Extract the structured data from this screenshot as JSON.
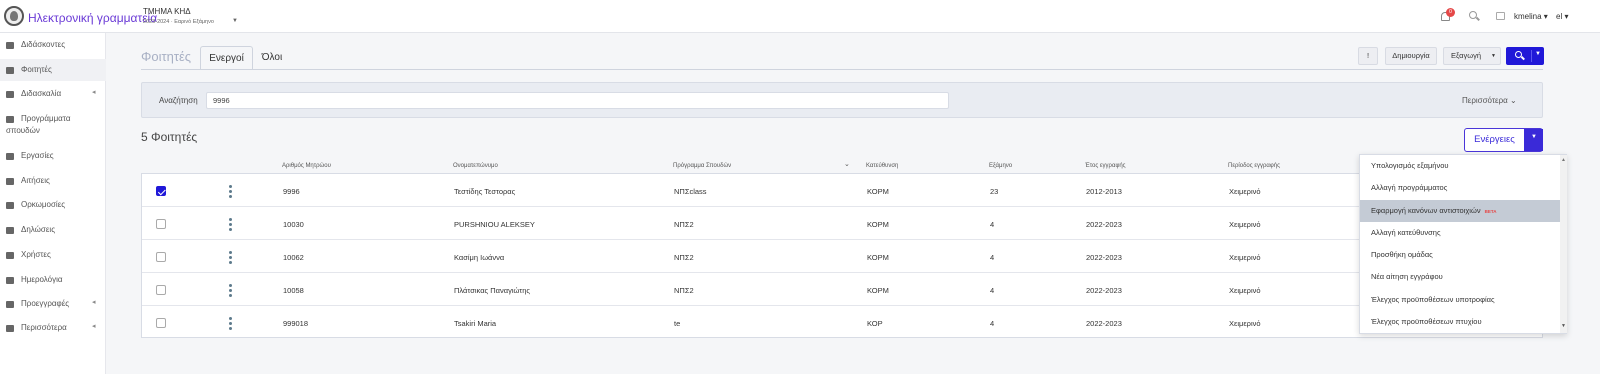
{
  "header": {
    "app_title": "Ηλεκτρονική γραμματεία",
    "department": "ΤΜΗΜΑ ΚΗΔ",
    "period": "2023-2024 · Εαρινό Εξάμηνο",
    "notification_count": "0",
    "username": "kmelina",
    "language": "el"
  },
  "sidebar": {
    "items": [
      {
        "label": "Διδάσκοντες",
        "icon": "megaphone-icon"
      },
      {
        "label": "Φοιτητές",
        "icon": "graduation-cap-icon"
      },
      {
        "label": "Διδασκαλία",
        "icon": "history-icon"
      },
      {
        "label": "Προγράμματα σπουδών",
        "icon": "institution-icon"
      },
      {
        "label": "Εργασίες",
        "icon": "briefcase-icon"
      },
      {
        "label": "Αιτήσεις",
        "icon": "envelope-icon"
      },
      {
        "label": "Ορκωμοσίες",
        "icon": "user-graduate-icon"
      },
      {
        "label": "Δηλώσεις",
        "icon": "copy-icon"
      },
      {
        "label": "Χρήστες",
        "icon": "user-icon"
      },
      {
        "label": "Ημερολόγια",
        "icon": "calendar-icon"
      },
      {
        "label": "Προεγγραφές",
        "icon": "file-icon"
      },
      {
        "label": "Περισσότερα",
        "icon": "more-icon"
      }
    ]
  },
  "page": {
    "title": "Φοιτητές",
    "tabs": [
      "Ενεργοί",
      "Όλοι"
    ],
    "toolbar": {
      "info": "!",
      "create": "Δημιουργία",
      "export": "Εξαγωγή"
    }
  },
  "filter": {
    "label": "Αναζήτηση",
    "value": "9996",
    "more": "Περισσότερα"
  },
  "results": {
    "count_label": "5 Φοιτητές",
    "actions_label": "Ενέργειες"
  },
  "table": {
    "columns": [
      "Αριθμός Μητρώου",
      "Ονοματεπώνυμο",
      "Πρόγραμμα Σπουδών",
      "Κατεύθυνση",
      "Εξάμηνο",
      "Έτος εγγραφής",
      "Περίοδος εγγραφής"
    ],
    "rows": [
      {
        "checked": true,
        "id": "9996",
        "name": "Τεστίδης Τεστορας",
        "program": "ΝΠΣclass",
        "direction": "ΚΟΡΜ",
        "semester": "23",
        "year": "2012-2013",
        "period": "Χειμερινό"
      },
      {
        "checked": false,
        "id": "10030",
        "name": "PURSHNIOU ALEKSEY",
        "program": "ΝΠΣ2",
        "direction": "ΚΟΡΜ",
        "semester": "4",
        "year": "2022-2023",
        "period": "Χειμερινό"
      },
      {
        "checked": false,
        "id": "10062",
        "name": "Κασίμη Ιωάννα",
        "program": "ΝΠΣ2",
        "direction": "ΚΟΡΜ",
        "semester": "4",
        "year": "2022-2023",
        "period": "Χειμερινό"
      },
      {
        "checked": false,
        "id": "10058",
        "name": "Πλάτσικας Παναγιώτης",
        "program": "ΝΠΣ2",
        "direction": "ΚΟΡΜ",
        "semester": "4",
        "year": "2022-2023",
        "period": "Χειμερινό"
      },
      {
        "checked": false,
        "id": "999018",
        "name": "Tsakiri Maria",
        "program": "te",
        "direction": "ΚΟΡ",
        "semester": "4",
        "year": "2022-2023",
        "period": "Χειμερινό"
      }
    ]
  },
  "dropdown": {
    "items": [
      "Υπολογισμός εξαμήνου",
      "Αλλαγή προγράμματος",
      "Εφαρμογή κανόνων αντιστοιχιών",
      "Αλλαγή κατεύθυνσης",
      "Προσθήκη ομάδας",
      "Νέα αίτηση εγγράφου",
      "Έλεγχος προϋποθέσεων υποτροφίας",
      "Έλεγχος προϋποθέσεων πτυχίου"
    ],
    "beta_badge": "BETA"
  },
  "colors": {
    "accent": "#2018d8",
    "brand_text": "#6a3ad6",
    "badge": "#e54848"
  }
}
